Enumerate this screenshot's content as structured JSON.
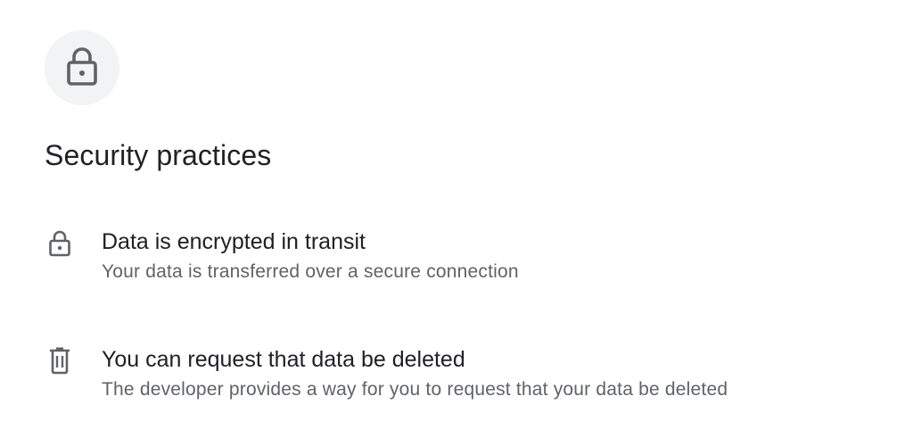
{
  "header": {
    "icon": "lock-icon",
    "title": "Security practices"
  },
  "practices": [
    {
      "icon": "lock-icon",
      "title": "Data is encrypted in transit",
      "description": "Your data is transferred over a secure connection"
    },
    {
      "icon": "trash-icon",
      "title": "You can request that data be deleted",
      "description": "The developer provides a way for you to request that your data be deleted"
    }
  ],
  "colors": {
    "icon": "#5f6368",
    "badge_background": "#f1f3f4",
    "title_text": "#202124",
    "secondary_text": "#5f6368"
  }
}
